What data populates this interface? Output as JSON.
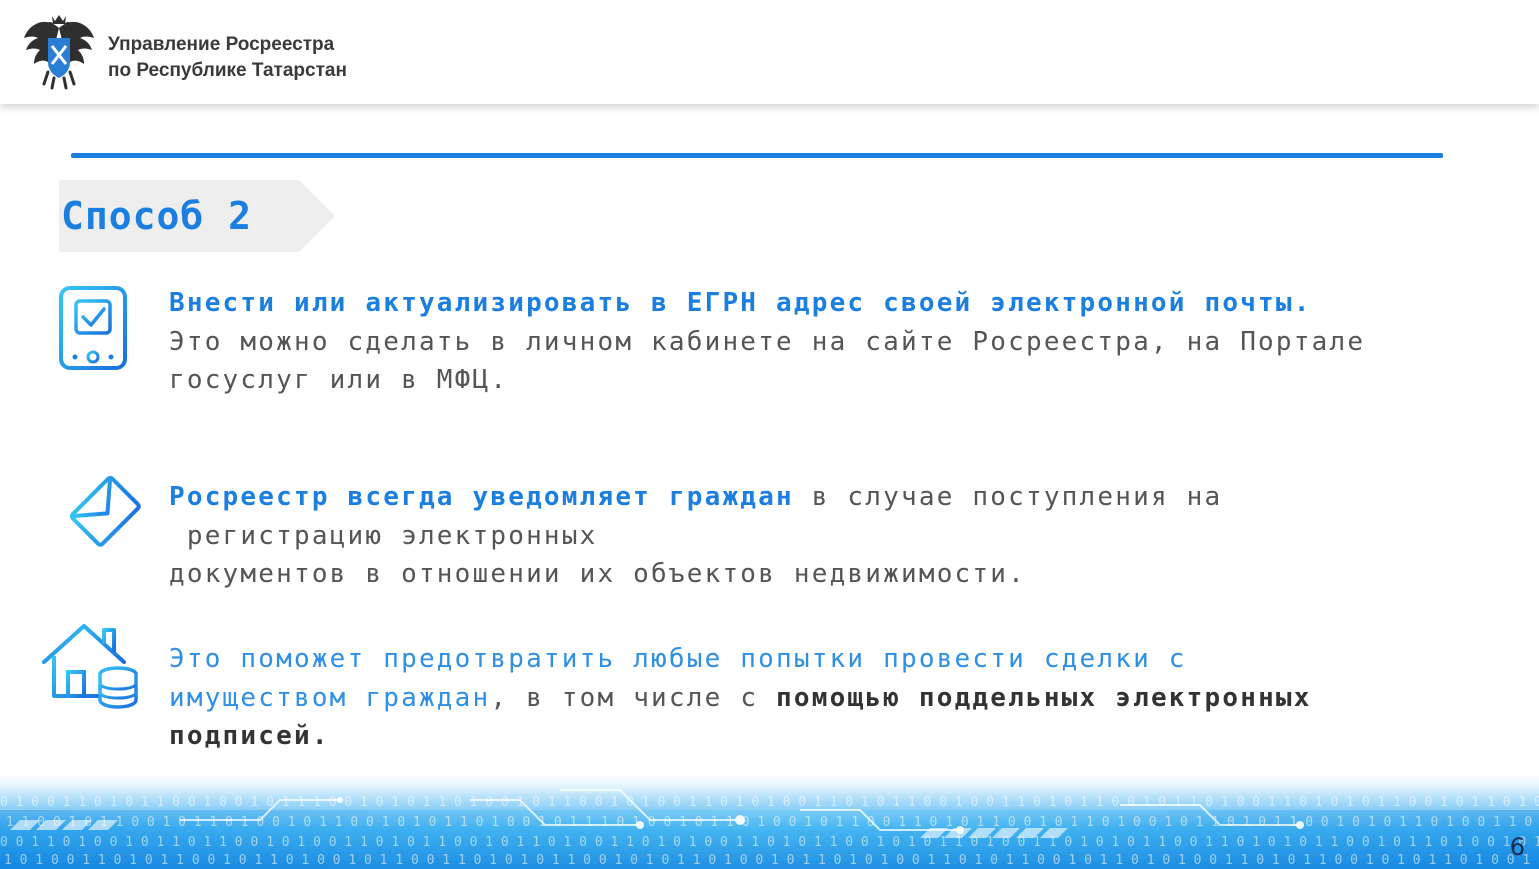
{
  "header": {
    "org_line1": "Управление Росреестра",
    "org_line2": "по Республике Татарстан"
  },
  "banner": {
    "title": "Способ 2"
  },
  "items": [
    {
      "icon": "phone-checkbox-icon",
      "highlight": "Внести или актуализировать в ЕГРН адрес своей электронной почты.",
      "text_line1": "Это можно сделать в личном кабинете на сайте Росреестра, на Портале",
      "text_line2": "госуслуг или в МФЦ."
    },
    {
      "icon": "email-envelope-icon",
      "highlight": "Росреестр всегда уведомляет граждан",
      "text_after": " в случае поступления на",
      "text_line2": " регистрацию электронных",
      "text_line3": "документов в отношении их объектов недвижимости."
    },
    {
      "icon": "house-coins-icon",
      "highlight_light_line1": "Это поможет предотвратить любые попытки провести сделки с",
      "highlight_light_line2": "имуществом граждан",
      "text_middle": ", в том числе с ",
      "bold_dark_line2": "помощью поддельных электронных",
      "bold_dark_line3": "подписей."
    }
  ],
  "colors": {
    "accent": "#1a7fe0",
    "body_text": "#555555",
    "banner_bg": "#eeeeee"
  },
  "page_number": "6"
}
